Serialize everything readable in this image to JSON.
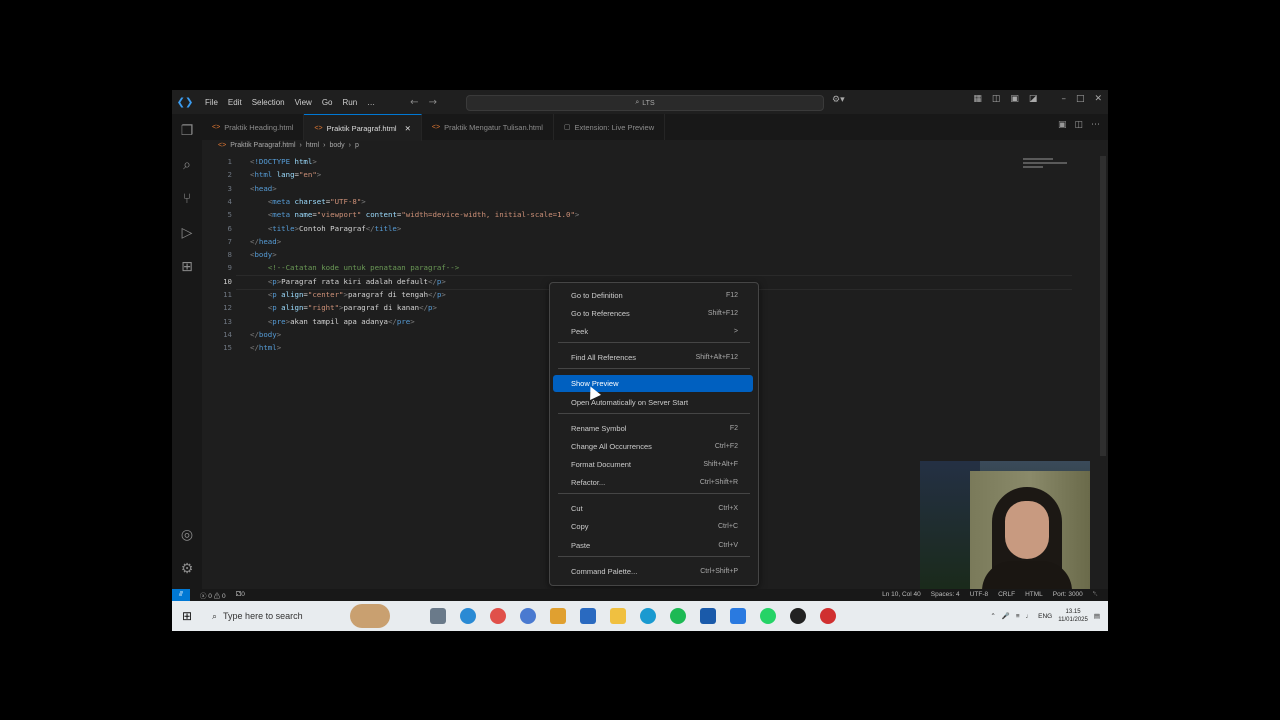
{
  "menu": [
    "File",
    "Edit",
    "Selection",
    "View",
    "Go",
    "Run",
    "…"
  ],
  "search": {
    "text": "LTS"
  },
  "tabs": [
    {
      "label": "Praktik Heading.html",
      "active": false
    },
    {
      "label": "Praktik Paragraf.html",
      "active": true
    },
    {
      "label": "Praktik Mengatur Tulisan.html",
      "active": false
    },
    {
      "label": "Extension: Live Preview",
      "active": false
    }
  ],
  "breadcrumb": [
    "Praktik Paragraf.html",
    "html",
    "body",
    "p"
  ],
  "code_lines": [
    "<!DOCTYPE html>",
    "<html lang=\"en\">",
    "<head>",
    "    <meta charset=\"UTF-8\">",
    "    <meta name=\"viewport\" content=\"width=device-width, initial-scale=1.0\">",
    "    <title>Contoh Paragraf</title>",
    "</head>",
    "<body>",
    "    <!--Catatan kode untuk penataan paragraf-->",
    "    <p>Paragraf rata kiri adalah default</p>",
    "    <p align=\"center\">paragraf di tengah</p>",
    "    <p align=\"right\">paragraf di kanan</p>",
    "    <pre>akan tampil apa adanya</pre>",
    "</body>",
    "</html>"
  ],
  "current_line": 10,
  "context_menu": [
    {
      "label": "Go to Definition",
      "shortcut": "F12"
    },
    {
      "label": "Go to References",
      "shortcut": "Shift+F12"
    },
    {
      "label": "Peek",
      "shortcut": ">"
    },
    {
      "label": "Find All References",
      "shortcut": "Shift+Alt+F12"
    },
    {
      "label": "Show Preview",
      "shortcut": "",
      "highlighted": true
    },
    {
      "label": "Open Automatically on Server Start",
      "shortcut": ""
    },
    {
      "label": "Rename Symbol",
      "shortcut": "F2"
    },
    {
      "label": "Change All Occurrences",
      "shortcut": "Ctrl+F2"
    },
    {
      "label": "Format Document",
      "shortcut": "Shift+Alt+F"
    },
    {
      "label": "Refactor...",
      "shortcut": "Ctrl+Shift+R"
    },
    {
      "label": "Cut",
      "shortcut": "Ctrl+X"
    },
    {
      "label": "Copy",
      "shortcut": "Ctrl+C"
    },
    {
      "label": "Paste",
      "shortcut": "Ctrl+V"
    },
    {
      "label": "Command Palette...",
      "shortcut": "Ctrl+Shift+P"
    }
  ],
  "statusbar": {
    "errors": "ⓧ 0 ⚠ 0",
    "ports": "⚁0",
    "position": "Ln 10, Col 40",
    "spaces": "Spaces: 4",
    "encoding": "UTF-8",
    "eol": "CRLF",
    "language": "HTML",
    "port": "Port: 3000"
  },
  "taskbar": {
    "search_placeholder": "Type here to search",
    "lang": "ENG",
    "time": "13.15",
    "date": "11/01/2025"
  },
  "colors": {
    "accent": "#0078d4",
    "highlight": "#0060c0",
    "editor_bg": "#1e1e1e"
  }
}
